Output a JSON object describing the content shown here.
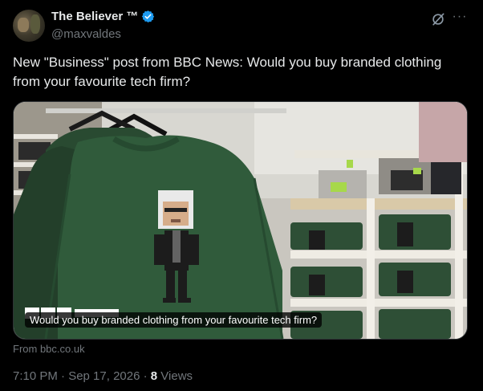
{
  "author": {
    "display_name": "The Believer ™",
    "handle": "@maxvaldes",
    "verified": true
  },
  "icons": {
    "verified": "verified-badge-icon",
    "grok": "grok-icon",
    "more": "more-options-icon"
  },
  "tweet": {
    "text": "New \"Business\" post from BBC News: Would you buy branded clothing from your favourite tech firm?"
  },
  "card": {
    "caption": "Would you buy branded clothing from your favourite tech firm?",
    "source": "From bbc.co.uk"
  },
  "meta": {
    "timestamp": "7:10 PM · Sep 17, 2026",
    "separator": "·",
    "views_count": "8",
    "views_label": "Views"
  },
  "colors": {
    "background": "#000000",
    "text": "#e7e9ea",
    "muted": "#71767b",
    "verified": "#1d9bf0",
    "sweater": "#2f5a3a"
  }
}
